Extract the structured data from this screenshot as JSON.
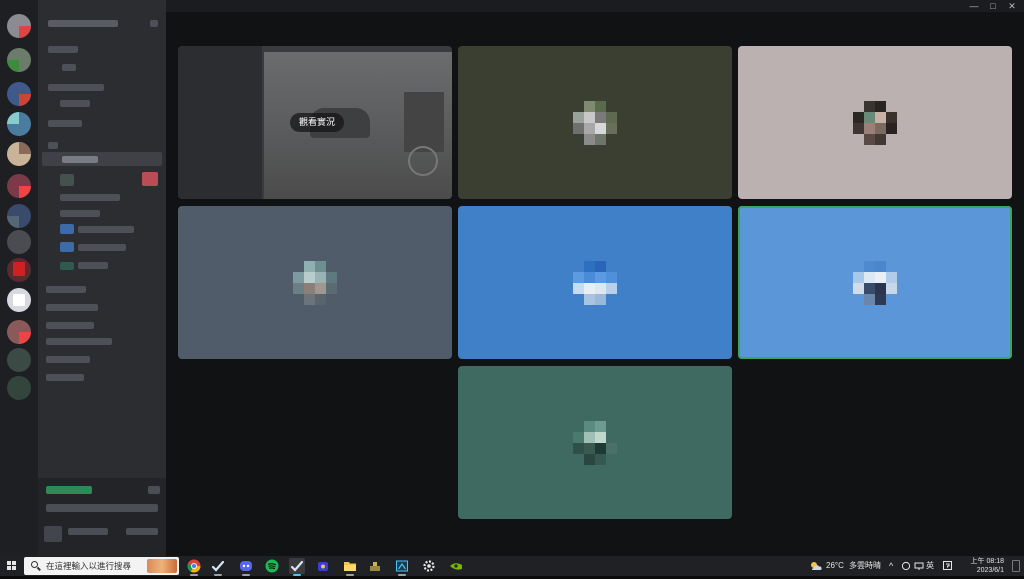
{
  "window": {
    "minimize": "—",
    "maximize": "□",
    "close": "✕"
  },
  "stage": {
    "share_tile": {
      "watch_label": "觀看實況"
    }
  },
  "taskbar": {
    "search_placeholder": "在這裡輸入以進行搜尋",
    "weather_temp": "26°C",
    "weather_desc": "多雲時晴",
    "ime": "英",
    "time": "上午 08:18",
    "date": "2023/6/1",
    "apps": [
      "chrome-icon",
      "steam-icon",
      "discord-icon",
      "spotify-icon",
      "steam-icon",
      "app-icon",
      "file-explorer-icon",
      "app-icon",
      "app-icon",
      "settings-icon",
      "nvidia-icon"
    ]
  },
  "colors": {
    "tile_olive": "#3b3f31",
    "tile_taupe": "#bab1b0",
    "tile_slate": "#505c69",
    "tile_blue": "#3f80c8",
    "tile_lightblue": "#5b96d8",
    "tile_teal": "#3f6a62",
    "speaking": "#3ba55c"
  }
}
